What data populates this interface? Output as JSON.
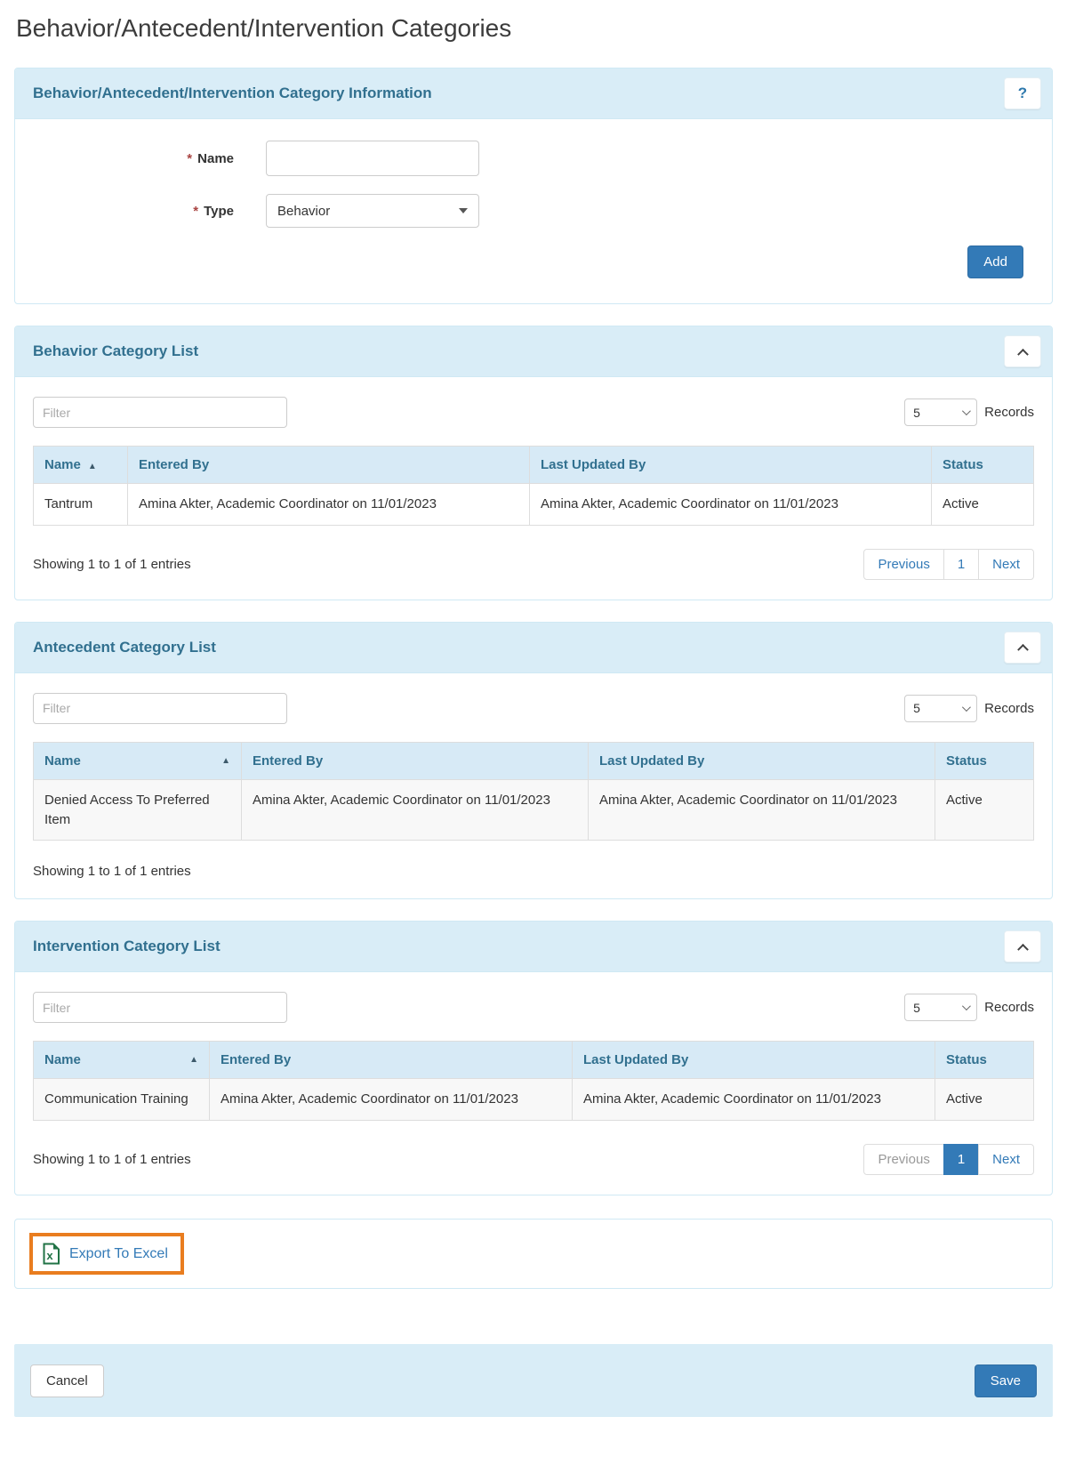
{
  "page_title": "Behavior/Antecedent/Intervention Categories",
  "info_panel": {
    "title": "Behavior/Antecedent/Intervention Category Information",
    "help_label": "?",
    "name_field": {
      "required": "*",
      "label": "Name",
      "value": ""
    },
    "type_field": {
      "required": "*",
      "label": "Type",
      "value": "Behavior"
    },
    "add_label": "Add"
  },
  "lists": [
    {
      "title": "Behavior Category List",
      "filter_placeholder": "Filter",
      "records_value": "5",
      "records_label": "Records",
      "sort_icon": "▲",
      "columns": {
        "name": "Name",
        "entered": "Entered By",
        "updated": "Last Updated By",
        "status": "Status"
      },
      "row": {
        "name": "Tantrum",
        "entered": "Amina Akter, Academic Coordinator on 11/01/2023",
        "updated": "Amina Akter, Academic Coordinator on 11/01/2023",
        "status": "Active"
      },
      "summary": "Showing 1 to 1 of 1 entries",
      "pagination": {
        "previous": "Previous",
        "page": "1",
        "next": "Next"
      }
    },
    {
      "title": "Antecedent Category List",
      "filter_placeholder": "Filter",
      "records_value": "5",
      "records_label": "Records",
      "sort_icon": "▲",
      "columns": {
        "name": "Name",
        "entered": "Entered By",
        "updated": "Last Updated By",
        "status": "Status"
      },
      "row": {
        "name": "Denied Access To Preferred Item",
        "entered": "Amina Akter, Academic Coordinator on 11/01/2023",
        "updated": "Amina Akter, Academic Coordinator on 11/01/2023",
        "status": "Active"
      },
      "summary": "Showing 1 to 1 of 1 entries"
    },
    {
      "title": "Intervention Category List",
      "filter_placeholder": "Filter",
      "records_value": "5",
      "records_label": "Records",
      "sort_icon": "▲",
      "columns": {
        "name": "Name",
        "entered": "Entered By",
        "updated": "Last Updated By",
        "status": "Status"
      },
      "row": {
        "name": "Communication Training",
        "entered": "Amina Akter, Academic Coordinator on 11/01/2023",
        "updated": "Amina Akter, Academic Coordinator on 11/01/2023",
        "status": "Active"
      },
      "summary": "Showing 1 to 1 of 1 entries",
      "pagination": {
        "previous": "Previous",
        "page": "1",
        "next": "Next"
      }
    }
  ],
  "export_panel": {
    "label": "Export To Excel"
  },
  "footer": {
    "cancel_label": "Cancel",
    "save_label": "Save"
  }
}
